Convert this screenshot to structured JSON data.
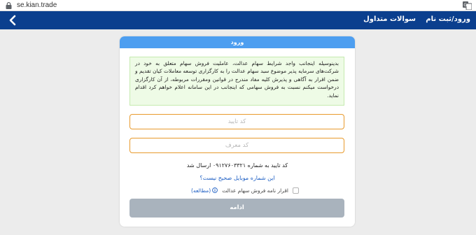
{
  "browser": {
    "url": "se.kian.trade",
    "lock_icon": "lock-icon",
    "translate_icon": "translate-icon"
  },
  "header": {
    "login_label": "ورود/ثبت نام",
    "faq_label": "سوالات متداول",
    "back_icon": "chevron-left-icon",
    "background": "#0b3f8e"
  },
  "card": {
    "title": "ورود",
    "title_color": "#4d9ef0",
    "notice": "بدینوسیله اینجانب واجد شرایط سهام عدالت، عاملیت فروش سهام متعلق به خود در شرکت‌های سرمایه پذیر موضوع سبد سهام عدالت را به کارگزاری توسعه معاملات کیان تقدیم و ضمن اقرار به آگاهی و پذیرش کلیه مفاد مندرج در قوانین ومقررات مربوطه، از آن کارگزاری درخواست میکنم نسبت به فروش سهامی که اینجانب در این سامانه اعلام خواهم کرد اقدام نمايد.",
    "code_placeholder": "کد تایید",
    "code_value": "",
    "ref_placeholder": "کد معرف",
    "ref_value": "",
    "sent_message": "کد تایید به شماره ۰۹۱۲۷۶۰۳۳۲۱ ارسال شد",
    "wrong_mobile": "این شماره موبایل صحیح نیست؟",
    "consent_label": "اقرار نامه فروش سهام عدالت",
    "study_label": "(مطالعه)",
    "consent_checked": false,
    "continue_label": "ادامه",
    "accent_orange": "#e89a2c",
    "button_disabled_color": "#a9b3bd"
  }
}
